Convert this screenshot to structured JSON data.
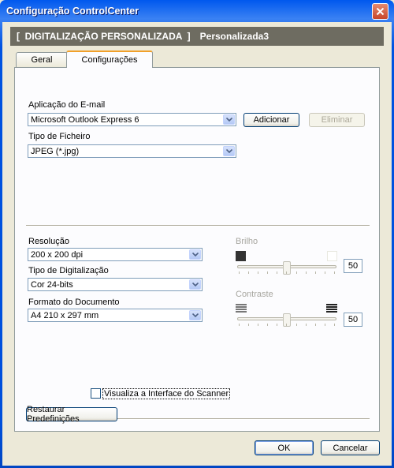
{
  "window": {
    "title": "Configuração ControlCenter"
  },
  "header": {
    "section": "[  DIGITALIZAÇÃO PERSONALIZADA  ]",
    "name": "Personalizada3"
  },
  "tabs": [
    {
      "label": "Geral",
      "active": false
    },
    {
      "label": "Configurações",
      "active": true
    }
  ],
  "email_app": {
    "label": "Aplicação do E-mail",
    "value": "Microsoft Outlook Express 6",
    "add_label": "Adicionar",
    "remove_label": "Eliminar"
  },
  "file_type": {
    "label": "Tipo de Ficheiro",
    "value": "JPEG (*.jpg)"
  },
  "resolution": {
    "label": "Resolução",
    "value": "200 x 200 dpi"
  },
  "scan_type": {
    "label": "Tipo de Digitalização",
    "value": "Cor 24-bits"
  },
  "doc_format": {
    "label": "Formato do Documento",
    "value": "A4 210 x 297 mm"
  },
  "brightness": {
    "label": "Brilho",
    "value": "50",
    "level": 0.5
  },
  "contrast": {
    "label": "Contraste",
    "value": "50",
    "level": 0.5
  },
  "scanner_ui": {
    "label": "Visualiza a Interface do Scanner",
    "checked": false
  },
  "restore_label": "Restaurar Predefinições",
  "ok_label": "OK",
  "cancel_label": "Cancelar",
  "colors": {
    "titlebar": "#0054e3",
    "banner": "#6e6c61",
    "tab_highlight": "#f1a02a"
  }
}
